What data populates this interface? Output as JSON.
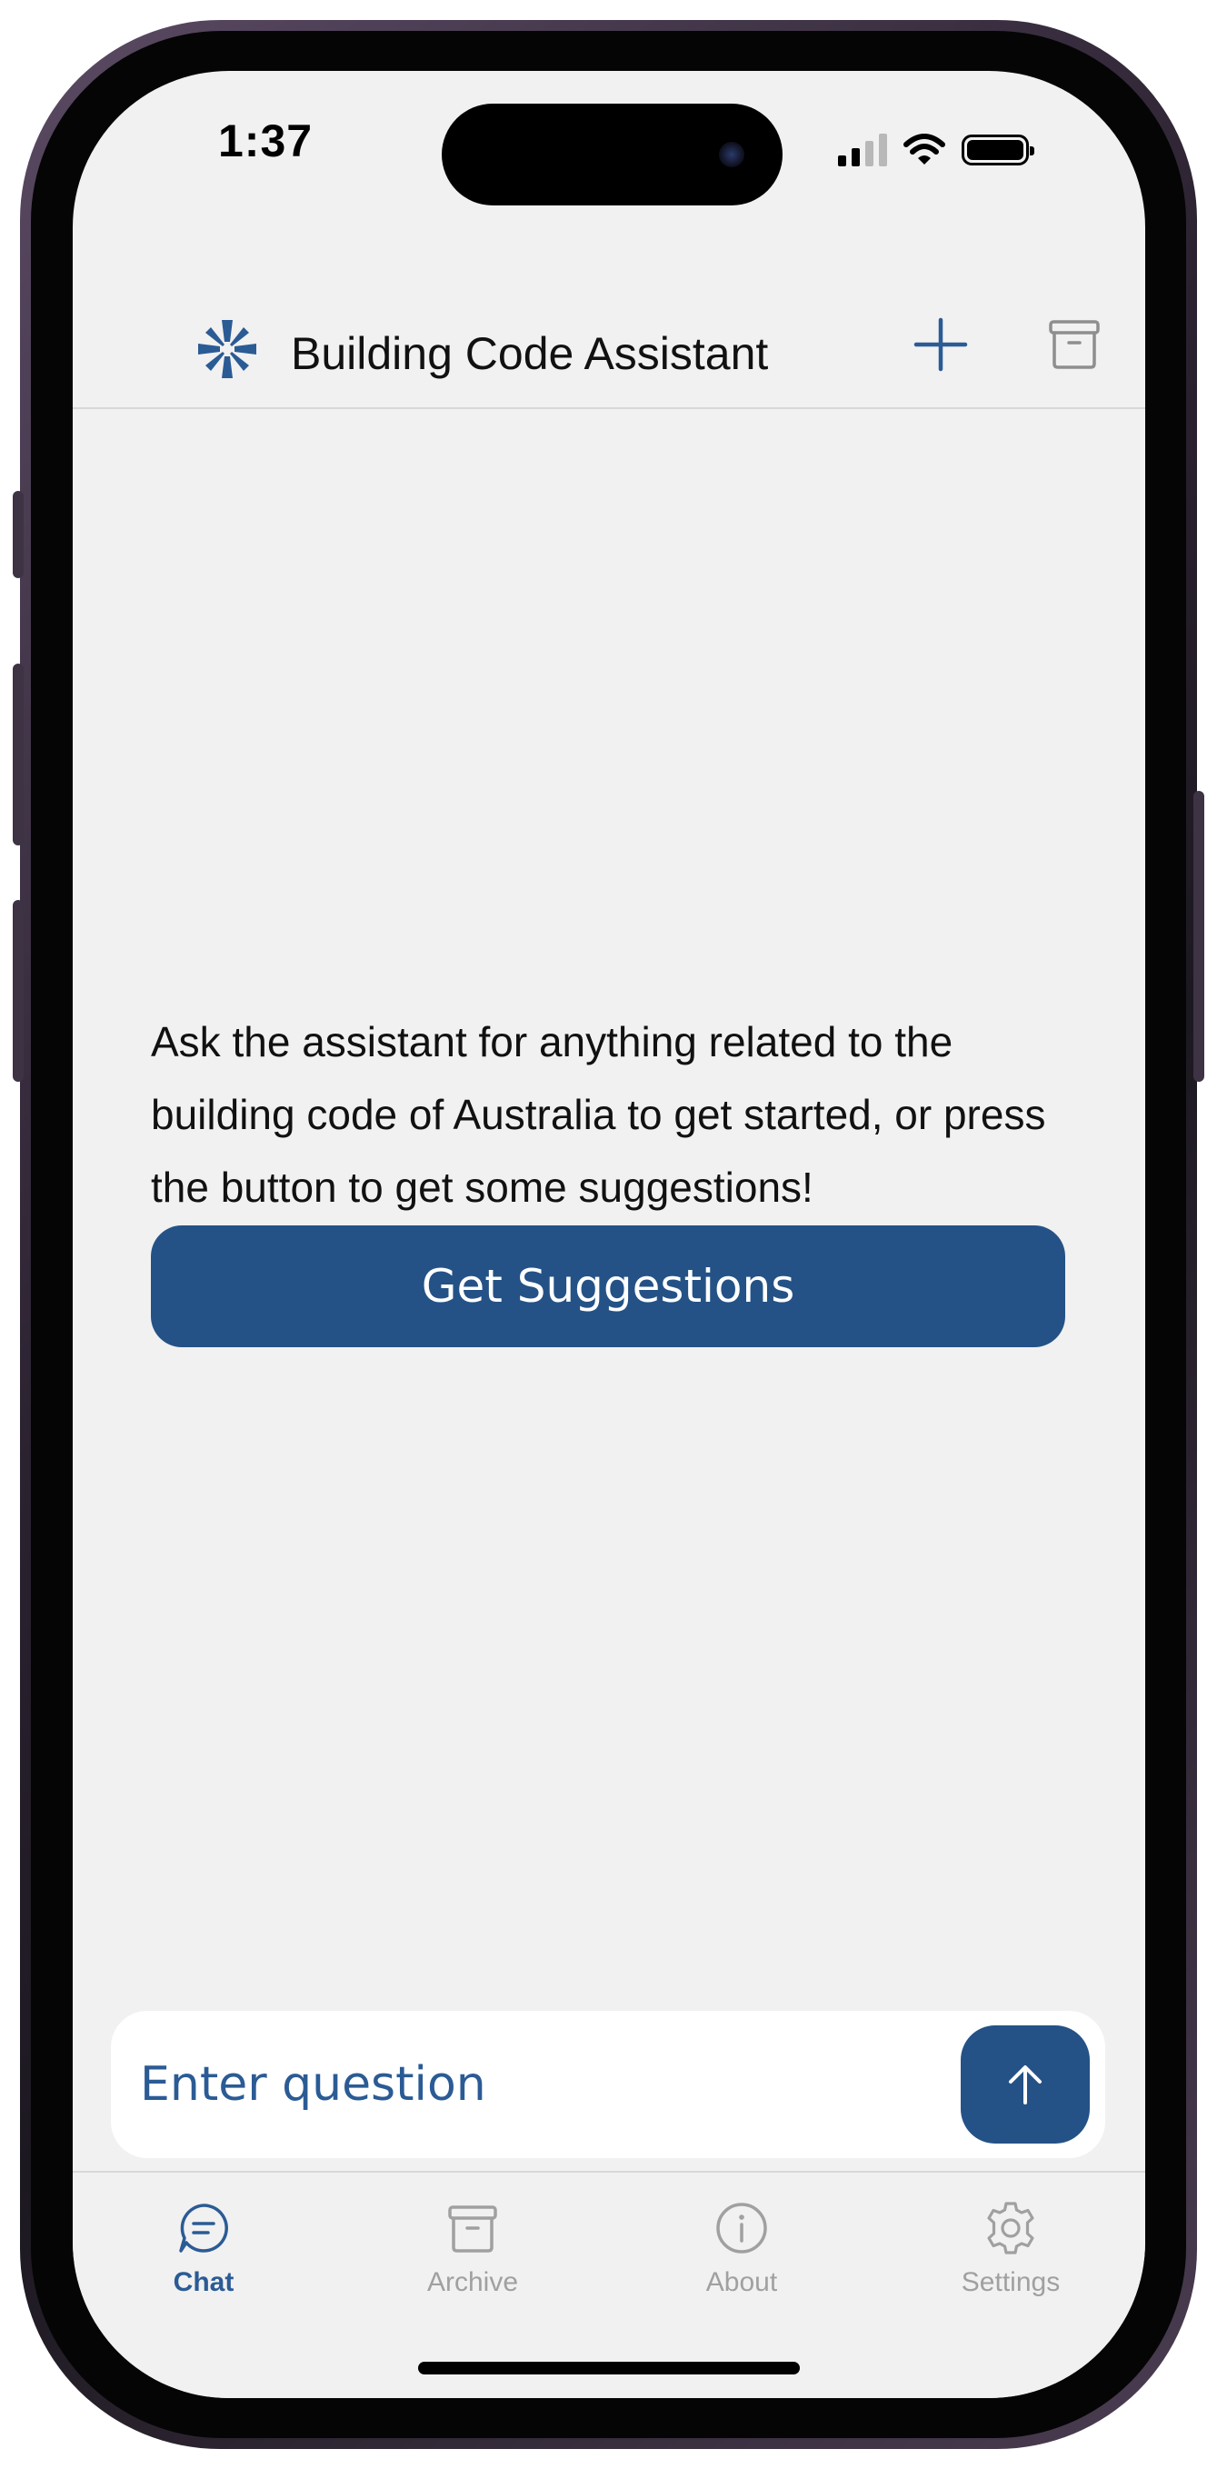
{
  "status": {
    "time": "1:37"
  },
  "header": {
    "title": "Building Code Assistant"
  },
  "main": {
    "intro_text": "Ask the assistant for anything related to the building code of Australia to get started, or press the button to get some suggestions!",
    "suggestions_button": "Get Suggestions"
  },
  "composer": {
    "placeholder": "Enter question"
  },
  "tabs": [
    {
      "label": "Chat",
      "icon": "chat-bubble-icon",
      "active": true
    },
    {
      "label": "Archive",
      "icon": "archive-box-icon",
      "active": false
    },
    {
      "label": "About",
      "icon": "info-circle-icon",
      "active": false
    },
    {
      "label": "Settings",
      "icon": "gear-icon",
      "active": false
    }
  ],
  "colors": {
    "accent": "#245286",
    "tab_active": "#2b5b95",
    "tab_inactive": "#a0a0a0",
    "background": "#f1f1f1"
  }
}
